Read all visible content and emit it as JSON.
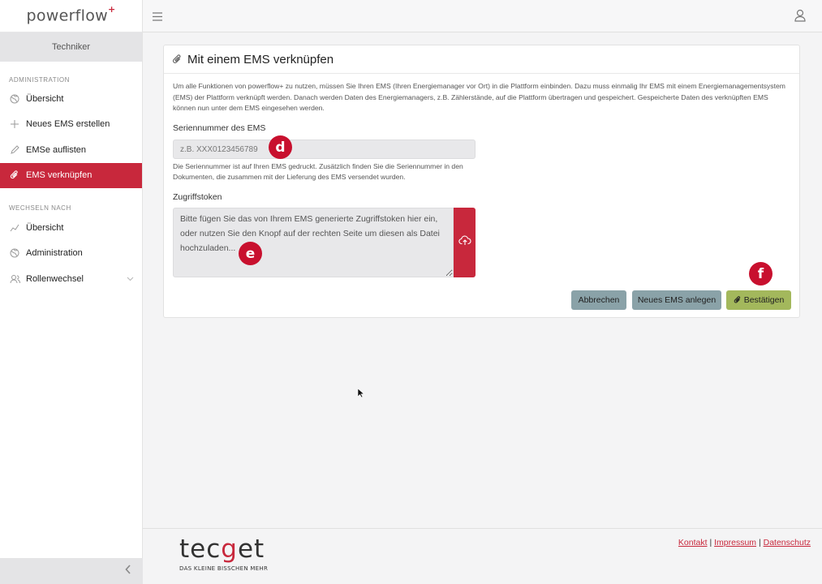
{
  "app": {
    "logo_text": "powerflow",
    "logo_plus": "+"
  },
  "sidebar": {
    "role": "Techniker",
    "section_admin": "ADMINISTRATION",
    "admin_items": [
      {
        "label": "Übersicht",
        "icon": "globe-icon"
      },
      {
        "label": "Neues EMS erstellen",
        "icon": "plus-icon"
      },
      {
        "label": "EMSe auflisten",
        "icon": "pencil-icon"
      },
      {
        "label": "EMS verknüpfen",
        "icon": "paperclip-icon",
        "active": true
      }
    ],
    "section_switch": "WECHSELN NACH",
    "switch_items": [
      {
        "label": "Übersicht",
        "icon": "chart-line-icon"
      },
      {
        "label": "Administration",
        "icon": "globe-icon"
      },
      {
        "label": "Rollenwechsel",
        "icon": "users-icon"
      }
    ]
  },
  "card": {
    "title": "Mit einem EMS verknüpfen",
    "intro": "Um alle Funktionen von powerflow+ zu nutzen, müssen Sie Ihren EMS (Ihren Energiemanager vor Ort) in die Plattform einbinden. Dazu muss einmalig Ihr EMS mit einem Energiemanagementsystem (EMS) der Plattform verknüpft werden. Danach werden Daten des Energiemanagers, z.B. Zählerstände, auf die Plattform übertragen und gespeichert. Gespeicherte Daten des verknüpften EMS können nun unter dem EMS eingesehen werden.",
    "serial_label": "Seriennummer des EMS",
    "serial_placeholder": "z.B. XXX0123456789",
    "serial_helper": "Die Seriennummer ist auf Ihren EMS gedruckt. Zusätzlich finden Sie die Seriennummer in den Dokumenten, die zusammen mit der Lieferung des EMS versendet wurden.",
    "token_label": "Zugriffstoken",
    "token_placeholder": "Bitte fügen Sie das von Ihrem EMS generierte Zugriffstoken hier ein, oder nutzen Sie den Knopf auf der rechten Seite um diesen als Datei hochzuladen...",
    "cancel": "Abbrechen",
    "new_ems": "Neues EMS anlegen",
    "confirm": "Bestätigen"
  },
  "markers": {
    "d": "d",
    "e": "e",
    "f": "f"
  },
  "footer": {
    "brand_a": "tec",
    "brand_g": "g",
    "brand_b": "et",
    "tagline": "DAS KLEINE BISSCHEN MEHR",
    "links": [
      "Kontakt",
      "Impressum",
      "Datenschutz"
    ],
    "separator": "|"
  },
  "colors": {
    "accent": "#c8283c",
    "secondary_button": "#8aa2a8",
    "confirm_button": "#a3b85c"
  }
}
